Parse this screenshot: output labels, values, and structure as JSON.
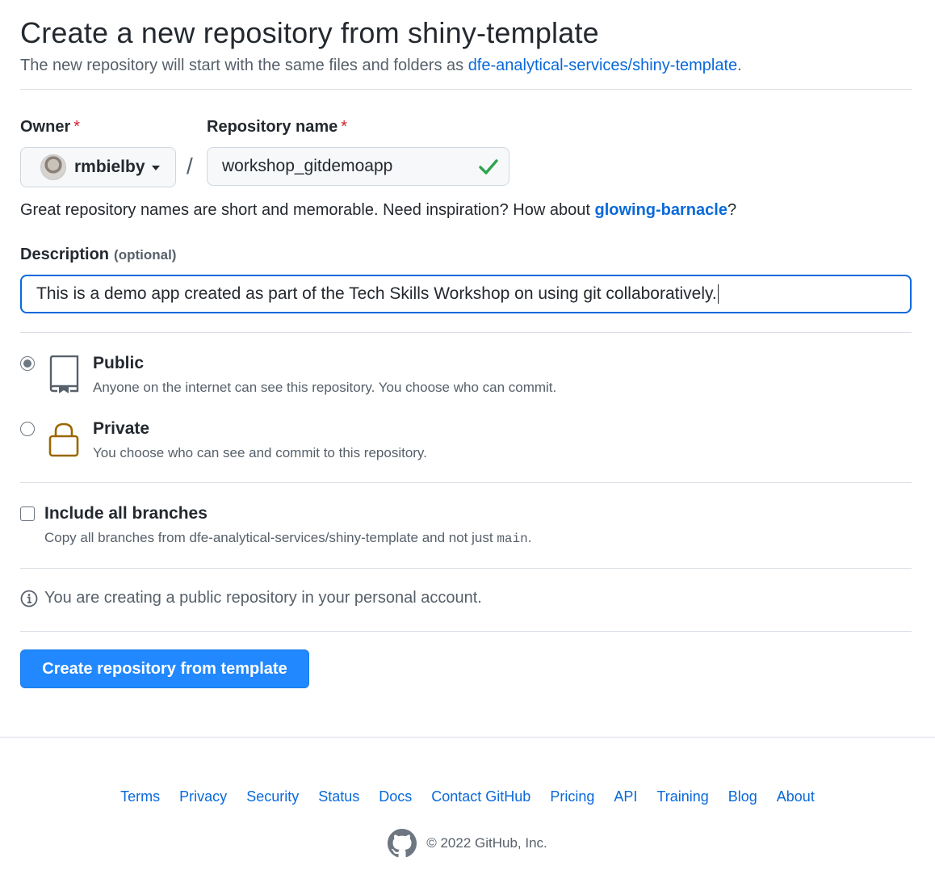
{
  "header": {
    "title": "Create a new repository from shiny-template",
    "subtitle_prefix": "The new repository will start with the same files and folders as ",
    "template_link": "dfe-analytical-services/shiny-template",
    "subtitle_suffix": "."
  },
  "owner": {
    "label": "Owner",
    "required_mark": "*",
    "value": "rmbielby"
  },
  "repo_name": {
    "label": "Repository name",
    "required_mark": "*",
    "value": "workshop_gitdemoapp",
    "status": "valid"
  },
  "slash": "/",
  "hint": {
    "text": "Great repository names are short and memorable. Need inspiration? How about ",
    "suggestion": "glowing-barnacle",
    "suffix": "?"
  },
  "description": {
    "label": "Description",
    "optional_label": "(optional)",
    "value": "This is a demo app created as part of the Tech Skills Workshop on using git collaboratively."
  },
  "visibility": {
    "selected": "Public",
    "options": [
      {
        "title": "Public",
        "desc": "Anyone on the internet can see this repository. You choose who can commit."
      },
      {
        "title": "Private",
        "desc": "You choose who can see and commit to this repository."
      }
    ]
  },
  "branches": {
    "label": "Include all branches",
    "checked": false,
    "desc_prefix": "Copy all branches from dfe-analytical-services/shiny-template and not just ",
    "desc_branch": "main",
    "desc_suffix": "."
  },
  "info_text": "You are creating a public repository in your personal account.",
  "submit_label": "Create repository from template",
  "footer": {
    "links": [
      "Terms",
      "Privacy",
      "Security",
      "Status",
      "Docs",
      "Contact GitHub",
      "Pricing",
      "API",
      "Training",
      "Blog",
      "About"
    ],
    "copyright": "© 2022 GitHub, Inc."
  },
  "colors": {
    "link": "#0969da",
    "primary_button": "#2188ff",
    "valid_check": "#2da44e",
    "private_lock": "#9a6700",
    "required": "#cf222e"
  }
}
